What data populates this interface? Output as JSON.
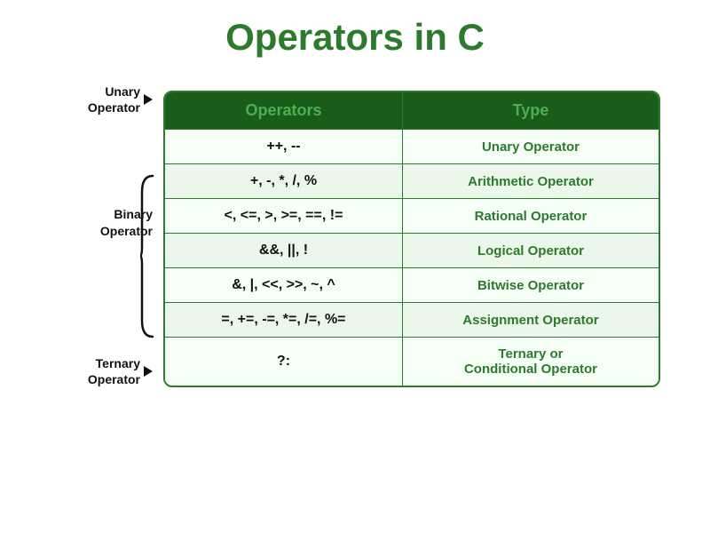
{
  "title": "Operators in C",
  "table": {
    "headers": [
      "Operators",
      "Type"
    ],
    "rows": [
      {
        "operators": "++, --",
        "type": "Unary Operator"
      },
      {
        "operators": "+, -, *, /, %",
        "type": "Arithmetic Operator"
      },
      {
        "operators": "<, <=, >, >=, ==, !=",
        "type": "Rational Operator"
      },
      {
        "operators": "&&, ||, !",
        "type": "Logical Operator"
      },
      {
        "operators": "&, |, <<, >>, ~, ^",
        "type": "Bitwise Operator"
      },
      {
        "operators": "=, +=, -=, *=, /=, %=",
        "type": "Assignment Operator"
      },
      {
        "operators": "?:",
        "type": "Ternary or\nConditional Operator"
      }
    ]
  },
  "labels": {
    "unary": "Unary\nOperator",
    "binary": "Binary\nOperator",
    "ternary": "Ternary\nOperator"
  },
  "colors": {
    "primary_green": "#2d7a2d",
    "header_bg": "#1a5c1a",
    "header_text": "#4caf50"
  }
}
